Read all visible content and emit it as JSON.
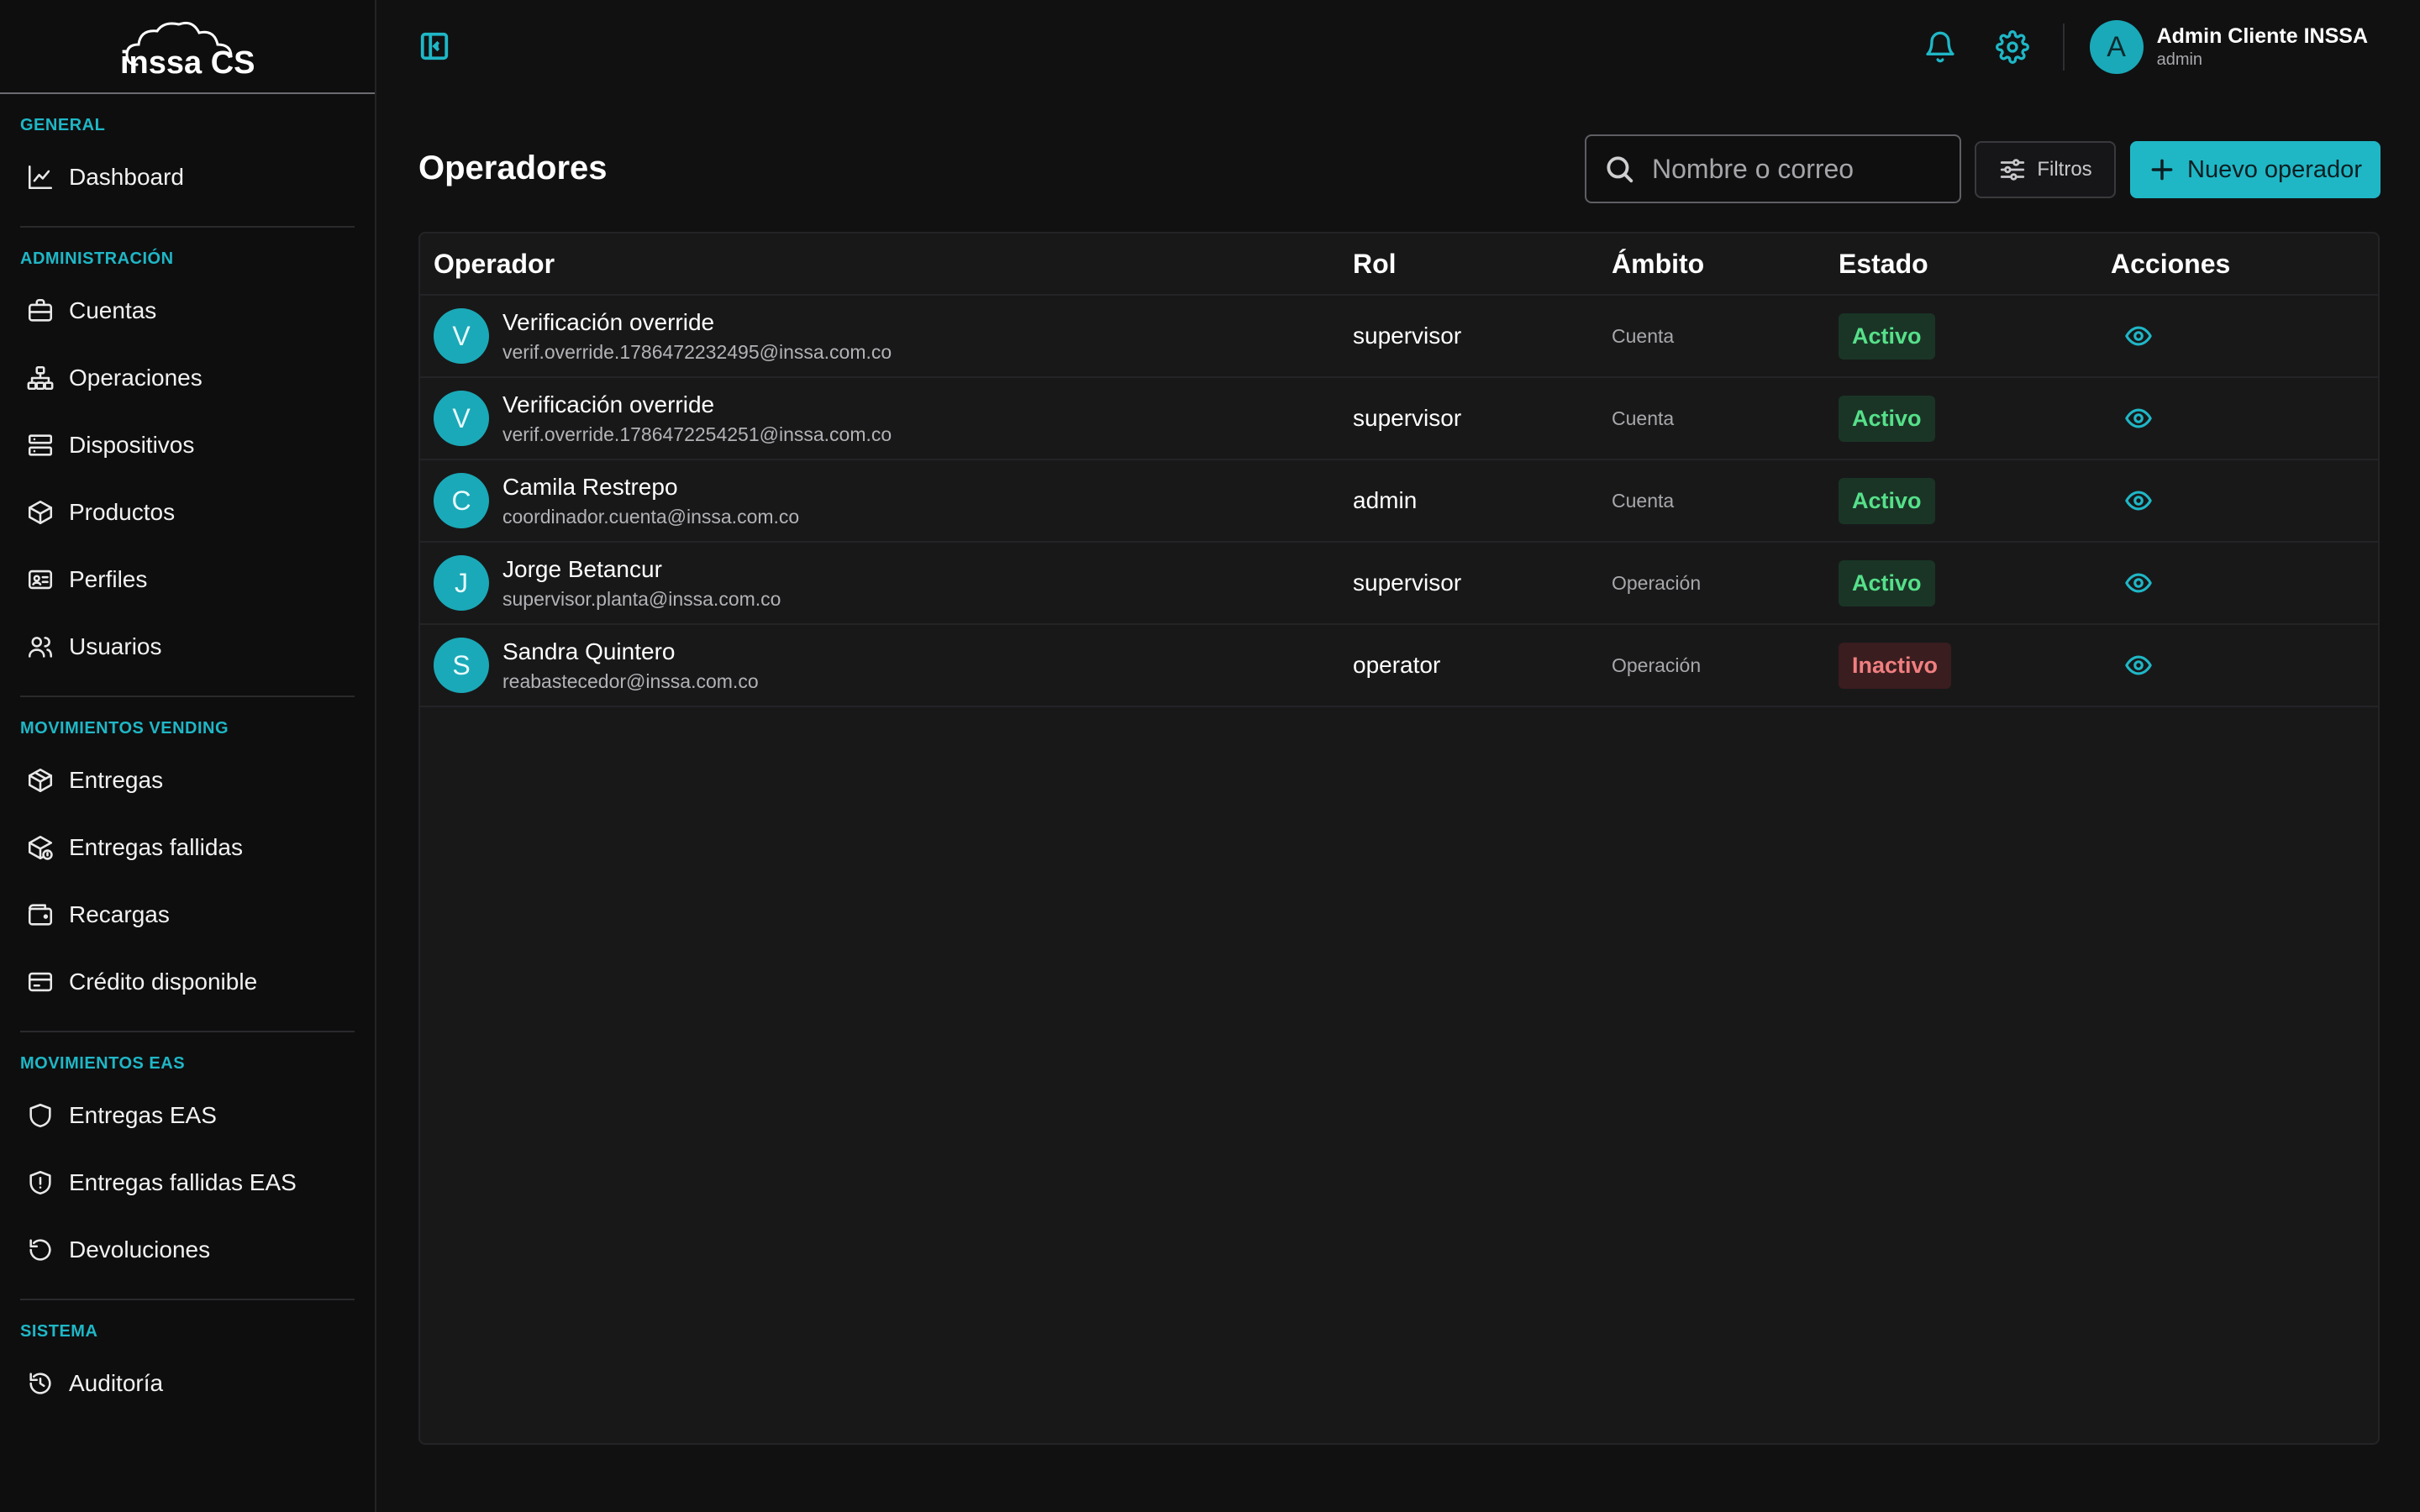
{
  "brand": {
    "logo_text": "inssa CS"
  },
  "sidebar": {
    "sections": [
      {
        "title": "GENERAL",
        "items": [
          {
            "label": "Dashboard",
            "icon": "chart-line-icon"
          }
        ]
      },
      {
        "title": "ADMINISTRACIÓN",
        "items": [
          {
            "label": "Cuentas",
            "icon": "briefcase-icon"
          },
          {
            "label": "Operaciones",
            "icon": "hierarchy-icon"
          },
          {
            "label": "Dispositivos",
            "icon": "server-icon"
          },
          {
            "label": "Productos",
            "icon": "box-icon"
          },
          {
            "label": "Perfiles",
            "icon": "id-card-icon"
          },
          {
            "label": "Usuarios",
            "icon": "users-icon"
          }
        ]
      },
      {
        "title": "MOVIMIENTOS VENDING",
        "items": [
          {
            "label": "Entregas",
            "icon": "package-icon"
          },
          {
            "label": "Entregas fallidas",
            "icon": "package-alert-icon"
          },
          {
            "label": "Recargas",
            "icon": "wallet-icon"
          },
          {
            "label": "Crédito disponible",
            "icon": "credit-card-icon"
          }
        ]
      },
      {
        "title": "MOVIMIENTOS EAS",
        "items": [
          {
            "label": "Entregas EAS",
            "icon": "shield-icon"
          },
          {
            "label": "Entregas fallidas EAS",
            "icon": "shield-alert-icon"
          },
          {
            "label": "Devoluciones",
            "icon": "rotate-ccw-icon"
          }
        ]
      },
      {
        "title": "SISTEMA",
        "items": [
          {
            "label": "Auditoría",
            "icon": "history-icon"
          }
        ]
      }
    ]
  },
  "topbar": {
    "user": {
      "initial": "A",
      "name": "Admin Cliente INSSA",
      "role": "admin"
    }
  },
  "main": {
    "title": "Operadores",
    "search_placeholder": "Nombre o correo",
    "filters_label": "Filtros",
    "new_button_label": "Nuevo operador",
    "table": {
      "columns": [
        "Operador",
        "Rol",
        "Ámbito",
        "Estado",
        "Acciones"
      ],
      "rows": [
        {
          "initial": "V",
          "name": "Verificación override",
          "email": "verif.override.1786472232495@inssa.com.co",
          "rol": "supervisor",
          "ambito": "Cuenta",
          "estado": "Activo",
          "status": "active"
        },
        {
          "initial": "V",
          "name": "Verificación override",
          "email": "verif.override.1786472254251@inssa.com.co",
          "rol": "supervisor",
          "ambito": "Cuenta",
          "estado": "Activo",
          "status": "active"
        },
        {
          "initial": "C",
          "name": "Camila Restrepo",
          "email": "coordinador.cuenta@inssa.com.co",
          "rol": "admin",
          "ambito": "Cuenta",
          "estado": "Activo",
          "status": "active"
        },
        {
          "initial": "J",
          "name": "Jorge Betancur",
          "email": "supervisor.planta@inssa.com.co",
          "rol": "supervisor",
          "ambito": "Operación",
          "estado": "Activo",
          "status": "active"
        },
        {
          "initial": "S",
          "name": "Sandra Quintero",
          "email": "reabastecedor@inssa.com.co",
          "rol": "operator",
          "ambito": "Operación",
          "estado": "Inactivo",
          "status": "inactive"
        }
      ]
    }
  },
  "colors": {
    "accent": "#1fb7c6",
    "active": "#56e08a",
    "inactive": "#f07f80"
  }
}
